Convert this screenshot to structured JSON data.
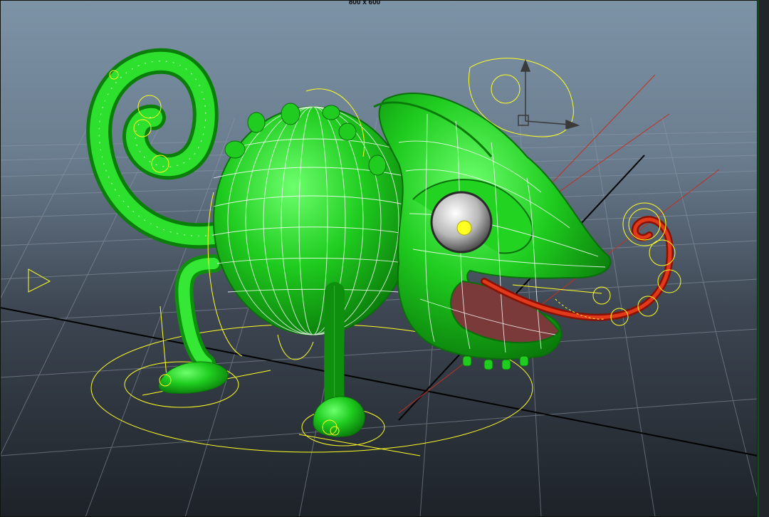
{
  "viewport": {
    "resolution_label": "800 x 600",
    "colors": {
      "body_green": "#1fcc1f",
      "wireframe": "#ffffff",
      "rig_controls": "#ffff22",
      "tongue_red": "#cc1a00",
      "grid_line": "#8f9aa6",
      "grid_axis": "#000000"
    },
    "icons": {
      "move_manipulator": "move-manipulator-icon",
      "camera_marker": "camera-marker-icon"
    },
    "model": {
      "name": "chameleon-rig"
    }
  }
}
